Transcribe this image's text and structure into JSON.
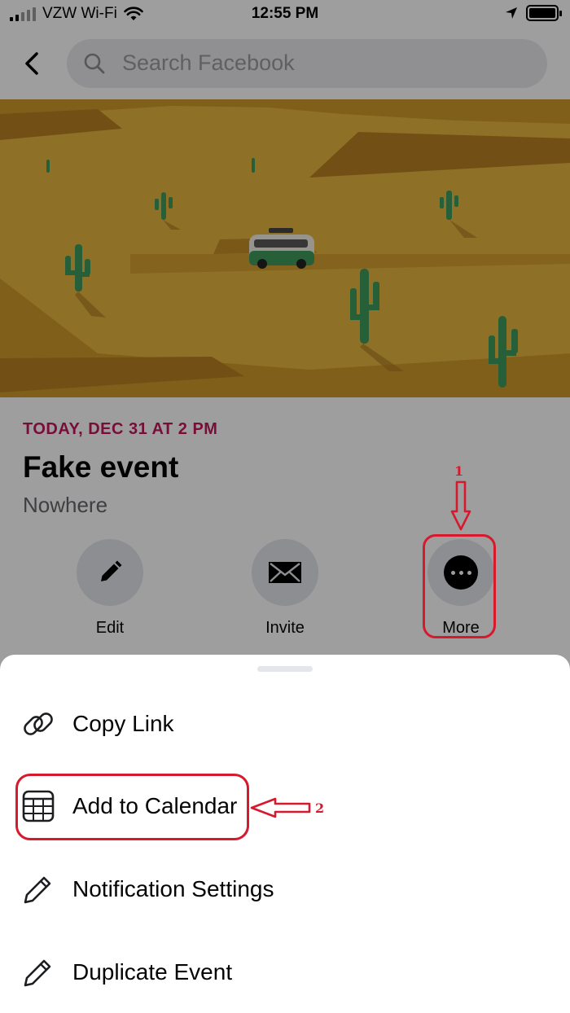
{
  "status_bar": {
    "carrier": "VZW Wi-Fi",
    "time": "12:55 PM"
  },
  "search": {
    "placeholder": "Search Facebook"
  },
  "event": {
    "date": "TODAY, DEC 31 AT 2 PM",
    "title": "Fake event",
    "location": "Nowhere"
  },
  "actions": {
    "edit": "Edit",
    "invite": "Invite",
    "more": "More"
  },
  "menu": {
    "copy_link": "Copy Link",
    "add_to_calendar": "Add to Calendar",
    "notification_settings": "Notification Settings",
    "duplicate_event": "Duplicate Event"
  },
  "annotations": {
    "step1": "1",
    "step2": "2",
    "color": "#d7192d"
  },
  "colors": {
    "date_accent": "#c2185b",
    "cover_background": "#e5b43c",
    "cactus": "#3f9a5b"
  }
}
